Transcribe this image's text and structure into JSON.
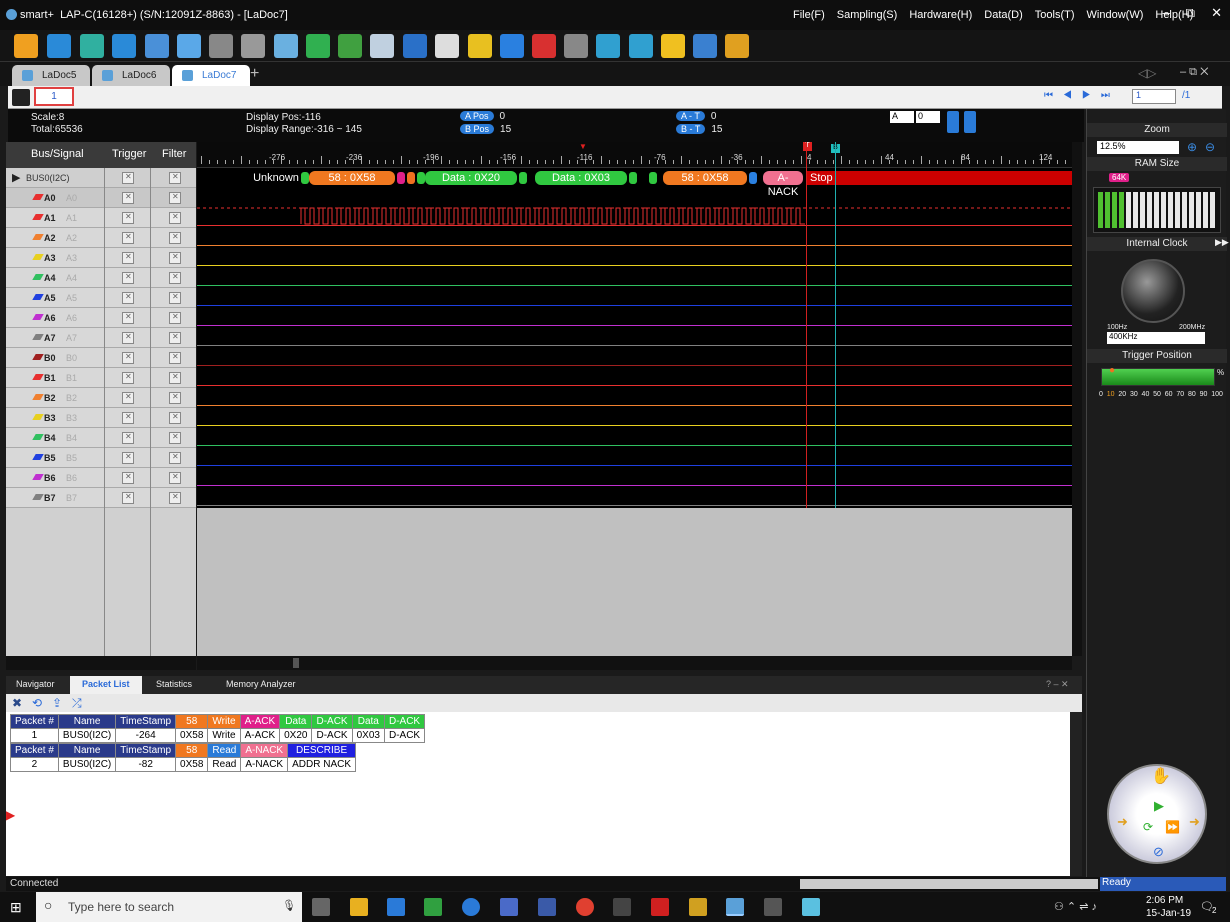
{
  "titlebar": {
    "app": "smart+",
    "title": "LAP-C(16128+) (S/N:12091Z-8863) - [LaDoc7]",
    "menus": [
      "File(F)",
      "Sampling(S)",
      "Hardware(H)",
      "Data(D)",
      "Tools(T)",
      "Window(W)",
      "Help(H)"
    ]
  },
  "doc_tabs": [
    "LaDoc5",
    "LaDoc6",
    "LaDoc7"
  ],
  "subbar": {
    "page_field": "1",
    "goto_value": "1",
    "page_total": "/1"
  },
  "info": {
    "scale": "Scale:8",
    "total": "Total:65536",
    "display_pos": "Display Pos:-116",
    "display_range": "Display Range:-316 ~ 145",
    "a_pos_label": "A Pos",
    "a_pos": "0",
    "b_pos_label": "B Pos",
    "b_pos": "15",
    "a_t_label": "A - T",
    "a_t": "0",
    "b_t_label": "B - T",
    "b_t": "15",
    "sel_a": "A",
    "sel_0": "0"
  },
  "signals_header": {
    "bus": "Bus/Signal",
    "trigger": "Trigger",
    "filter": "Filter"
  },
  "bus": {
    "name": "BUS0(I2C)"
  },
  "channels": [
    {
      "name": "A0",
      "alias": "A0",
      "color": "#e83030"
    },
    {
      "name": "A1",
      "alias": "A1",
      "color": "#e83030"
    },
    {
      "name": "A2",
      "alias": "A2",
      "color": "#f08030"
    },
    {
      "name": "A3",
      "alias": "A3",
      "color": "#e8d020"
    },
    {
      "name": "A4",
      "alias": "A4",
      "color": "#30c060"
    },
    {
      "name": "A5",
      "alias": "A5",
      "color": "#2040e0"
    },
    {
      "name": "A6",
      "alias": "A6",
      "color": "#c030d0"
    },
    {
      "name": "A7",
      "alias": "A7",
      "color": "#808080"
    },
    {
      "name": "B0",
      "alias": "B0",
      "color": "#a02020"
    },
    {
      "name": "B1",
      "alias": "B1",
      "color": "#e83030"
    },
    {
      "name": "B2",
      "alias": "B2",
      "color": "#f08030"
    },
    {
      "name": "B3",
      "alias": "B3",
      "color": "#e8d020"
    },
    {
      "name": "B4",
      "alias": "B4",
      "color": "#30c060"
    },
    {
      "name": "B5",
      "alias": "B5",
      "color": "#2040e0"
    },
    {
      "name": "B6",
      "alias": "B6",
      "color": "#c030d0"
    },
    {
      "name": "B7",
      "alias": "B7",
      "color": "#808080"
    }
  ],
  "ruler_ticks": [
    "-276",
    "-236",
    "-196",
    "-156",
    "-116",
    "-76",
    "-36",
    "4",
    "44",
    "84",
    "124"
  ],
  "decode_segments": [
    {
      "text": "Unknown",
      "color": "#000000"
    },
    {
      "text": "58 : 0X58",
      "color": "#f07820"
    },
    {
      "text": "Data : 0X20",
      "color": "#30c840"
    },
    {
      "text": "Data : 0X03",
      "color": "#30c840"
    },
    {
      "text": "58 : 0X58",
      "color": "#f07820"
    },
    {
      "text": "A-NACK",
      "color": "#f07090"
    },
    {
      "text": "Stop",
      "color": "#cc0000"
    }
  ],
  "cursor_labels": {
    "t": "T",
    "b": "B"
  },
  "right_panel": {
    "zoom_label": "Zoom",
    "zoom_value": "12.5%",
    "ram_label": "RAM Size",
    "ram_value": "64K",
    "clock_label": "Internal Clock",
    "clock_min": "100Hz",
    "clock_max": "200MHz",
    "clock_value": "400KHz",
    "trigger_label": "Trigger Position",
    "trigger_pct": "%",
    "trigger_scale": [
      "0",
      "10",
      "20",
      "30",
      "40",
      "50",
      "60",
      "70",
      "80",
      "90",
      "100"
    ]
  },
  "bottom_tabs": [
    "Navigator",
    "Packet List",
    "Statistics",
    "Memory Analyzer"
  ],
  "packets": [
    {
      "headers": [
        "Packet #",
        "Name",
        "TimeStamp",
        "58",
        "Write",
        "A-ACK",
        "Data",
        "D-ACK",
        "Data",
        "D-ACK"
      ],
      "values": [
        "1",
        "BUS0(I2C)",
        "-264",
        "0X58",
        "Write",
        "A-ACK",
        "0X20",
        "D-ACK",
        "0X03",
        "D-ACK"
      ],
      "colors": [
        "#2a3a8a",
        "#2a3a8a",
        "#2a3a8a",
        "#f07820",
        "#f07820",
        "#e0208a",
        "#30c840",
        "#30c840",
        "#30c840",
        "#30c840"
      ]
    },
    {
      "headers": [
        "Packet #",
        "Name",
        "TimeStamp",
        "58",
        "Read",
        "A-NACK",
        "DESCRIBE"
      ],
      "values": [
        "2",
        "BUS0(I2C)",
        "-82",
        "0X58",
        "Read",
        "A-NACK",
        "ADDR NACK"
      ],
      "colors": [
        "#2a3a8a",
        "#2a3a8a",
        "#2a3a8a",
        "#f07820",
        "#2a7bd8",
        "#f07090",
        "#2020e0"
      ]
    }
  ],
  "status": {
    "left": "Connected",
    "right": "Ready"
  },
  "taskbar": {
    "search_placeholder": "Type here to search",
    "time": "2:06 PM",
    "date": "15-Jan-19",
    "notif": "2"
  }
}
